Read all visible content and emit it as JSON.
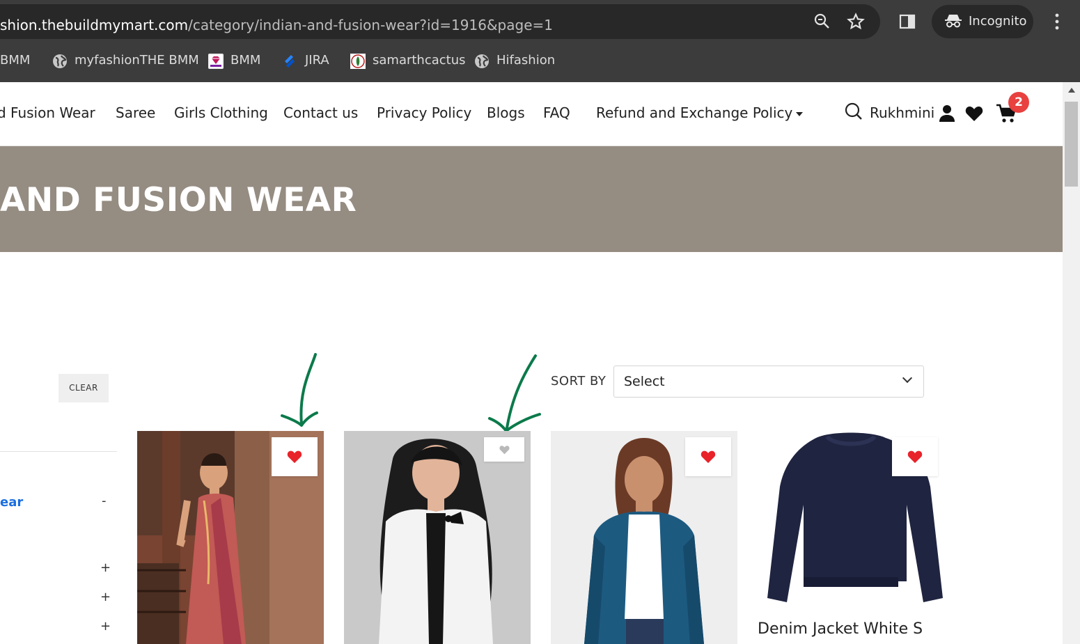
{
  "browser": {
    "url_host": "shion.thebuildmymart.com",
    "url_path": "/category/indian-and-fusion-wear?id=1916&page=1",
    "incognito_label": "Incognito",
    "bookmarks": [
      {
        "label": "BMM"
      },
      {
        "label": "myfashionTHE BMM"
      },
      {
        "label": "BMM"
      },
      {
        "label": "JIRA"
      },
      {
        "label": "samarthcactus"
      },
      {
        "label": "Hifashion"
      }
    ]
  },
  "nav": {
    "items": [
      {
        "label": "d Fusion Wear"
      },
      {
        "label": "Saree"
      },
      {
        "label": "Girls Clothing"
      },
      {
        "label": "Contact us"
      },
      {
        "label": "Privacy Policy"
      },
      {
        "label": "Blogs"
      },
      {
        "label": "FAQ"
      },
      {
        "label": "Refund and Exchange Policy"
      }
    ],
    "user_name": "Rukhmini",
    "cart_count": "2"
  },
  "banner": {
    "title": "AND FUSION WEAR",
    "color": "#958c82"
  },
  "sidebar": {
    "clear_label": "CLEAR",
    "active_category": "ear",
    "active_toggle": "-",
    "toggles": [
      "+",
      "+",
      "+"
    ]
  },
  "sort": {
    "label": "SORT BY",
    "value": "Select"
  },
  "products": [
    {
      "name": "saree-product",
      "wishlisted": true
    },
    {
      "name": "white-bolero-product",
      "wishlisted": false
    },
    {
      "name": "teal-shrug-product",
      "wishlisted": true
    },
    {
      "name": "navy-sweatshirt-product",
      "wishlisted": true,
      "title": "Denim Jacket White S"
    }
  ],
  "colors": {
    "accent_link": "#1b6fe0",
    "wishlist_active": "#e8232a",
    "wishlist_inactive": "#b9b9b9",
    "badge": "#e8413f",
    "annotation": "#0b7a4a"
  }
}
